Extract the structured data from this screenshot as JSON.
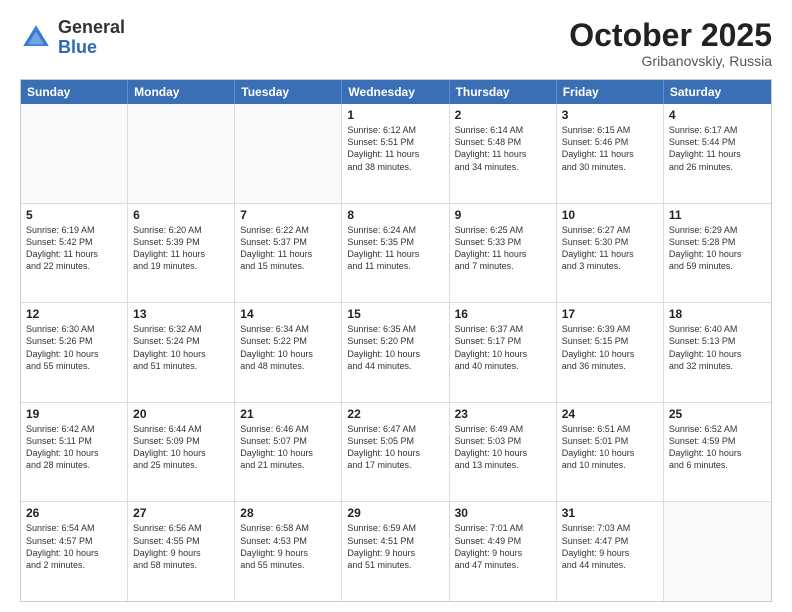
{
  "header": {
    "logo_general": "General",
    "logo_blue": "Blue",
    "month_title": "October 2025",
    "location": "Gribanovskiy, Russia"
  },
  "weekdays": [
    "Sunday",
    "Monday",
    "Tuesday",
    "Wednesday",
    "Thursday",
    "Friday",
    "Saturday"
  ],
  "rows": [
    [
      {
        "day": "",
        "lines": []
      },
      {
        "day": "",
        "lines": []
      },
      {
        "day": "",
        "lines": []
      },
      {
        "day": "1",
        "lines": [
          "Sunrise: 6:12 AM",
          "Sunset: 5:51 PM",
          "Daylight: 11 hours",
          "and 38 minutes."
        ]
      },
      {
        "day": "2",
        "lines": [
          "Sunrise: 6:14 AM",
          "Sunset: 5:48 PM",
          "Daylight: 11 hours",
          "and 34 minutes."
        ]
      },
      {
        "day": "3",
        "lines": [
          "Sunrise: 6:15 AM",
          "Sunset: 5:46 PM",
          "Daylight: 11 hours",
          "and 30 minutes."
        ]
      },
      {
        "day": "4",
        "lines": [
          "Sunrise: 6:17 AM",
          "Sunset: 5:44 PM",
          "Daylight: 11 hours",
          "and 26 minutes."
        ]
      }
    ],
    [
      {
        "day": "5",
        "lines": [
          "Sunrise: 6:19 AM",
          "Sunset: 5:42 PM",
          "Daylight: 11 hours",
          "and 22 minutes."
        ]
      },
      {
        "day": "6",
        "lines": [
          "Sunrise: 6:20 AM",
          "Sunset: 5:39 PM",
          "Daylight: 11 hours",
          "and 19 minutes."
        ]
      },
      {
        "day": "7",
        "lines": [
          "Sunrise: 6:22 AM",
          "Sunset: 5:37 PM",
          "Daylight: 11 hours",
          "and 15 minutes."
        ]
      },
      {
        "day": "8",
        "lines": [
          "Sunrise: 6:24 AM",
          "Sunset: 5:35 PM",
          "Daylight: 11 hours",
          "and 11 minutes."
        ]
      },
      {
        "day": "9",
        "lines": [
          "Sunrise: 6:25 AM",
          "Sunset: 5:33 PM",
          "Daylight: 11 hours",
          "and 7 minutes."
        ]
      },
      {
        "day": "10",
        "lines": [
          "Sunrise: 6:27 AM",
          "Sunset: 5:30 PM",
          "Daylight: 11 hours",
          "and 3 minutes."
        ]
      },
      {
        "day": "11",
        "lines": [
          "Sunrise: 6:29 AM",
          "Sunset: 5:28 PM",
          "Daylight: 10 hours",
          "and 59 minutes."
        ]
      }
    ],
    [
      {
        "day": "12",
        "lines": [
          "Sunrise: 6:30 AM",
          "Sunset: 5:26 PM",
          "Daylight: 10 hours",
          "and 55 minutes."
        ]
      },
      {
        "day": "13",
        "lines": [
          "Sunrise: 6:32 AM",
          "Sunset: 5:24 PM",
          "Daylight: 10 hours",
          "and 51 minutes."
        ]
      },
      {
        "day": "14",
        "lines": [
          "Sunrise: 6:34 AM",
          "Sunset: 5:22 PM",
          "Daylight: 10 hours",
          "and 48 minutes."
        ]
      },
      {
        "day": "15",
        "lines": [
          "Sunrise: 6:35 AM",
          "Sunset: 5:20 PM",
          "Daylight: 10 hours",
          "and 44 minutes."
        ]
      },
      {
        "day": "16",
        "lines": [
          "Sunrise: 6:37 AM",
          "Sunset: 5:17 PM",
          "Daylight: 10 hours",
          "and 40 minutes."
        ]
      },
      {
        "day": "17",
        "lines": [
          "Sunrise: 6:39 AM",
          "Sunset: 5:15 PM",
          "Daylight: 10 hours",
          "and 36 minutes."
        ]
      },
      {
        "day": "18",
        "lines": [
          "Sunrise: 6:40 AM",
          "Sunset: 5:13 PM",
          "Daylight: 10 hours",
          "and 32 minutes."
        ]
      }
    ],
    [
      {
        "day": "19",
        "lines": [
          "Sunrise: 6:42 AM",
          "Sunset: 5:11 PM",
          "Daylight: 10 hours",
          "and 28 minutes."
        ]
      },
      {
        "day": "20",
        "lines": [
          "Sunrise: 6:44 AM",
          "Sunset: 5:09 PM",
          "Daylight: 10 hours",
          "and 25 minutes."
        ]
      },
      {
        "day": "21",
        "lines": [
          "Sunrise: 6:46 AM",
          "Sunset: 5:07 PM",
          "Daylight: 10 hours",
          "and 21 minutes."
        ]
      },
      {
        "day": "22",
        "lines": [
          "Sunrise: 6:47 AM",
          "Sunset: 5:05 PM",
          "Daylight: 10 hours",
          "and 17 minutes."
        ]
      },
      {
        "day": "23",
        "lines": [
          "Sunrise: 6:49 AM",
          "Sunset: 5:03 PM",
          "Daylight: 10 hours",
          "and 13 minutes."
        ]
      },
      {
        "day": "24",
        "lines": [
          "Sunrise: 6:51 AM",
          "Sunset: 5:01 PM",
          "Daylight: 10 hours",
          "and 10 minutes."
        ]
      },
      {
        "day": "25",
        "lines": [
          "Sunrise: 6:52 AM",
          "Sunset: 4:59 PM",
          "Daylight: 10 hours",
          "and 6 minutes."
        ]
      }
    ],
    [
      {
        "day": "26",
        "lines": [
          "Sunrise: 6:54 AM",
          "Sunset: 4:57 PM",
          "Daylight: 10 hours",
          "and 2 minutes."
        ]
      },
      {
        "day": "27",
        "lines": [
          "Sunrise: 6:56 AM",
          "Sunset: 4:55 PM",
          "Daylight: 9 hours",
          "and 58 minutes."
        ]
      },
      {
        "day": "28",
        "lines": [
          "Sunrise: 6:58 AM",
          "Sunset: 4:53 PM",
          "Daylight: 9 hours",
          "and 55 minutes."
        ]
      },
      {
        "day": "29",
        "lines": [
          "Sunrise: 6:59 AM",
          "Sunset: 4:51 PM",
          "Daylight: 9 hours",
          "and 51 minutes."
        ]
      },
      {
        "day": "30",
        "lines": [
          "Sunrise: 7:01 AM",
          "Sunset: 4:49 PM",
          "Daylight: 9 hours",
          "and 47 minutes."
        ]
      },
      {
        "day": "31",
        "lines": [
          "Sunrise: 7:03 AM",
          "Sunset: 4:47 PM",
          "Daylight: 9 hours",
          "and 44 minutes."
        ]
      },
      {
        "day": "",
        "lines": []
      }
    ]
  ]
}
